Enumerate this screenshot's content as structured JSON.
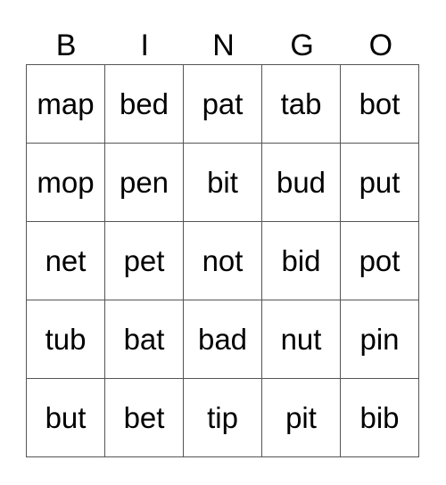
{
  "header": [
    "B",
    "I",
    "N",
    "G",
    "O"
  ],
  "rows": [
    [
      "map",
      "bed",
      "pat",
      "tab",
      "bot"
    ],
    [
      "mop",
      "pen",
      "bit",
      "bud",
      "put"
    ],
    [
      "net",
      "pet",
      "not",
      "bid",
      "pot"
    ],
    [
      "tub",
      "bat",
      "bad",
      "nut",
      "pin"
    ],
    [
      "but",
      "bet",
      "tip",
      "pit",
      "bib"
    ]
  ]
}
